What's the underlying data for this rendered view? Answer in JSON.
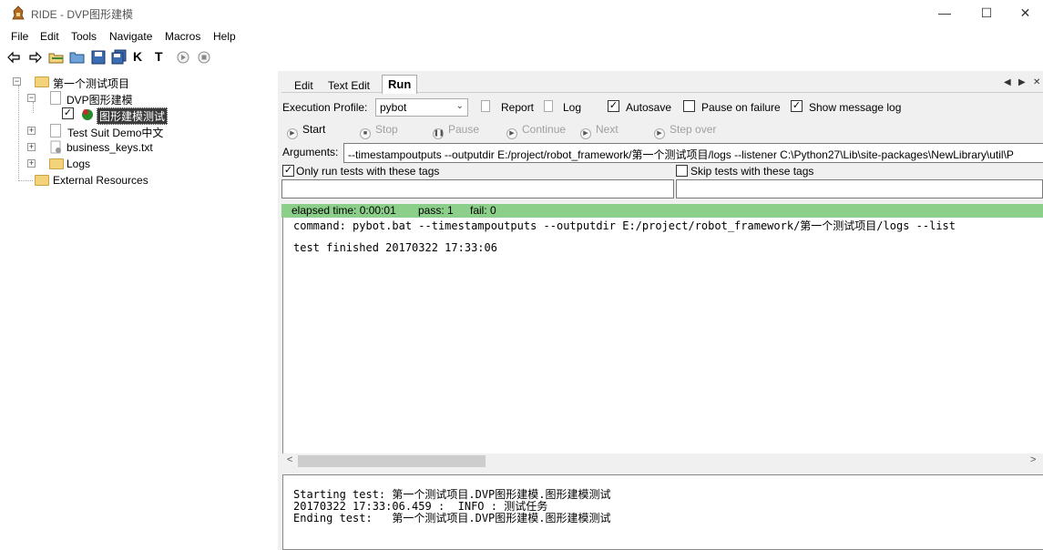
{
  "window": {
    "title": "RIDE - DVP图形建模",
    "minimize": "—",
    "maximize": "☐",
    "close": "✕"
  },
  "menu": [
    "File",
    "Edit",
    "Tools",
    "Navigate",
    "Macros",
    "Help"
  ],
  "toolbar": {
    "icons": [
      "back-arrow-icon",
      "forward-arrow-icon",
      "open-folder-icon",
      "open-directory-icon",
      "save-icon",
      "save-all-icon",
      "keyword-search-icon",
      "test-search-icon",
      "run-icon",
      "stop-icon"
    ],
    "k_label": "K",
    "t_label": "T"
  },
  "tree": {
    "root": "第一个测试项目",
    "suite": "DVP图形建模",
    "test_case": "图形建模测试",
    "items": [
      "Test Suit Demo中文",
      "business_keys.txt",
      "Logs"
    ],
    "external": "External Resources"
  },
  "tabs": {
    "edit": "Edit",
    "text_edit": "Text Edit",
    "run": "Run",
    "nav_left": "◀",
    "nav_right": "▶",
    "nav_close": "✕"
  },
  "run": {
    "execution_profile_label": "Execution Profile:",
    "execution_profile_value": "pybot",
    "report_label": "Report",
    "log_label": "Log",
    "autosave_label": "Autosave",
    "autosave_checked": true,
    "pause_on_failure_label": "Pause on failure",
    "pause_on_failure_checked": false,
    "show_message_log_label": "Show message log",
    "show_message_log_checked": true,
    "controls": {
      "start": "Start",
      "stop": "Stop",
      "pause": "Pause",
      "continue": "Continue",
      "next": "Next",
      "step_over": "Step over"
    },
    "arguments_label": "Arguments:",
    "arguments_value": "--timestampoutputs --outputdir E:/project/robot_framework/第一个测试项目/logs --listener C:\\Python27\\Lib\\site-packages\\NewLibrary\\util\\P",
    "only_run_tags_label": "Only run tests with these tags",
    "only_run_tags_checked": true,
    "skip_tags_label": "Skip tests with these tags",
    "skip_tags_checked": false,
    "status": {
      "elapsed": "elapsed time: 0:00:01",
      "pass": "pass: 1",
      "fail": "fail: 0",
      "color": "#8ccf8a"
    },
    "output": {
      "command": "command: pybot.bat --timestampoutputs --outputdir E:/project/robot_framework/第一个测试项目/logs --list",
      "finished": "test finished 20170322 17:33:06"
    },
    "message_log": [
      "Starting test: 第一个测试项目.DVP图形建模.图形建模测试",
      "20170322 17:33:06.459 :  INFO : 测试任务",
      "Ending test:   第一个测试项目.DVP图形建模.图形建模测试"
    ]
  }
}
